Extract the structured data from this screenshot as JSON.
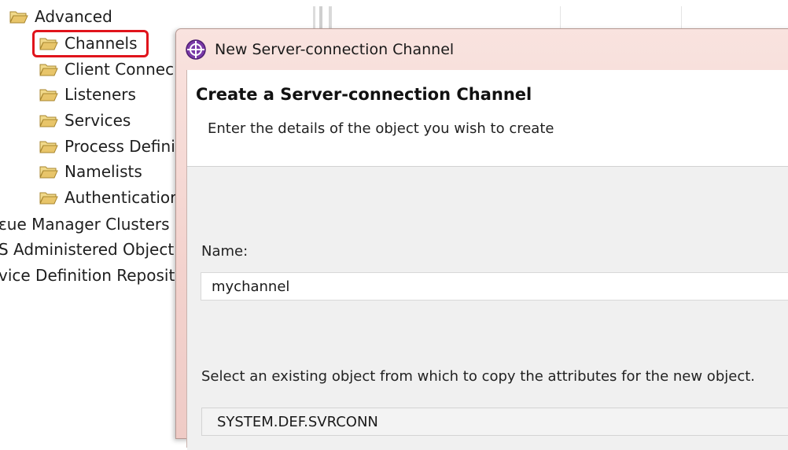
{
  "tree": {
    "items": [
      {
        "label": "Advanced"
      },
      {
        "label": "Channels"
      },
      {
        "label": "Client Connec"
      },
      {
        "label": "Listeners"
      },
      {
        "label": "Services"
      },
      {
        "label": "Process Defini"
      },
      {
        "label": "Namelists"
      },
      {
        "label": "Authenticatior"
      },
      {
        "label": "ɛue Manager Clusters"
      },
      {
        "label": "S Administered Object"
      },
      {
        "label": "vice Definition Reposit"
      }
    ]
  },
  "dialog": {
    "title": "New Server-connection Channel",
    "header_title": "Create a Server-connection Channel",
    "header_desc": "Enter the details of the object you wish to create",
    "name_label": "Name:",
    "name_value": "mychannel",
    "copy_label": "Select an existing object from which to copy the attributes for the new object.",
    "copy_value": "SYSTEM.DEF.SVRCONN"
  },
  "colors": {
    "highlight": "#e0141c",
    "folder": "#e8c56a",
    "dialog_frame": "#f3d2cd"
  },
  "icons": {
    "folder": "folder-open-icon",
    "app": "ibm-mq-explorer-icon"
  }
}
